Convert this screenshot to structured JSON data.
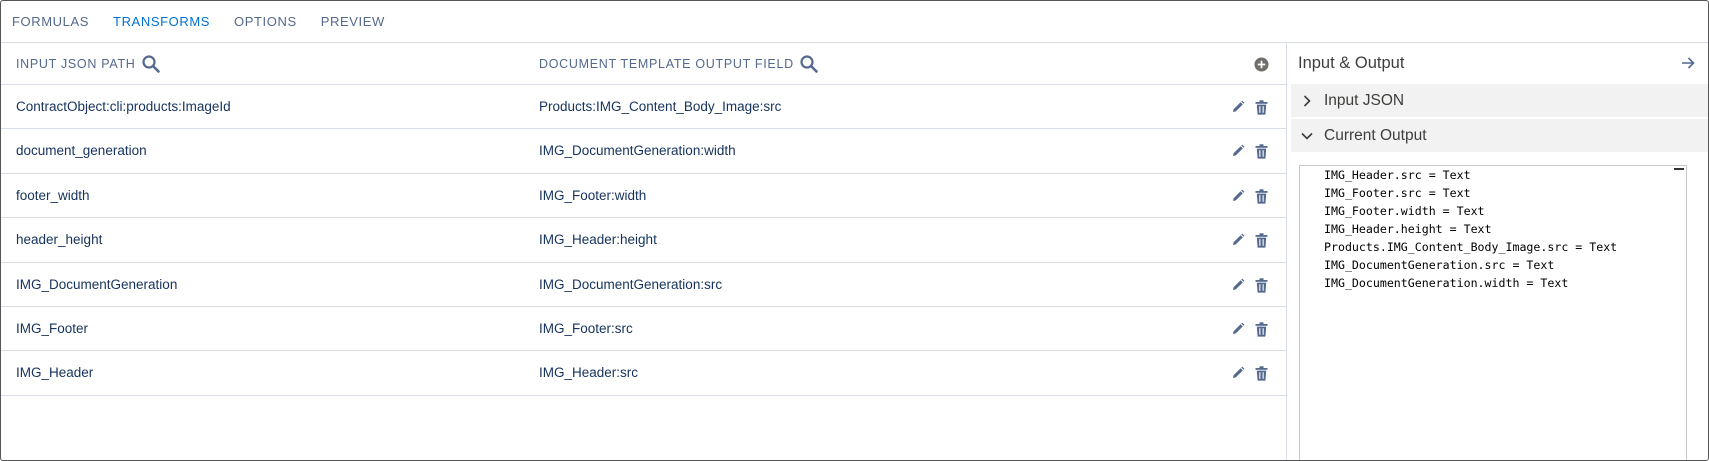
{
  "tabs": [
    {
      "label": "FORMULAS"
    },
    {
      "label": "TRANSFORMS"
    },
    {
      "label": "OPTIONS"
    },
    {
      "label": "PREVIEW"
    }
  ],
  "active_tab": "TRANSFORMS",
  "grid": {
    "columns": [
      "INPUT JSON PATH",
      "DOCUMENT TEMPLATE OUTPUT FIELD"
    ],
    "rows": [
      {
        "input": "ContractObject:cli:products:ImageId",
        "output": "Products:IMG_Content_Body_Image:src"
      },
      {
        "input": "document_generation",
        "output": "IMG_DocumentGeneration:width"
      },
      {
        "input": "footer_width",
        "output": "IMG_Footer:width"
      },
      {
        "input": "header_height",
        "output": "IMG_Header:height"
      },
      {
        "input": "IMG_DocumentGeneration",
        "output": "IMG_DocumentGeneration:src"
      },
      {
        "input": "IMG_Footer",
        "output": "IMG_Footer:src"
      },
      {
        "input": "IMG_Header",
        "output": "IMG_Header:src"
      }
    ]
  },
  "panel": {
    "title": "Input & Output",
    "sections": [
      {
        "label": "Input JSON",
        "expanded": false
      },
      {
        "label": "Current Output",
        "expanded": true
      }
    ],
    "output_lines": [
      "IMG_Header.src = Text",
      "IMG_Footer.src = Text",
      "IMG_Footer.width = Text",
      "IMG_Header.height = Text",
      "Products.IMG_Content_Body_Image.src = Text",
      "IMG_DocumentGeneration.src = Text",
      "IMG_DocumentGeneration.width = Text"
    ]
  },
  "icons": {
    "search": "search-icon",
    "add": "add-circle-icon",
    "edit": "pencil-icon",
    "delete": "trash-icon",
    "collapse_panel": "arrow-right-icon",
    "collapsed": "chevron-right-icon",
    "expanded": "chevron-down-icon"
  },
  "colors": {
    "active_tab": "#0070d2",
    "tab": "#54698d",
    "border": "#d8dde6",
    "section_bg": "#f3f2f2"
  }
}
